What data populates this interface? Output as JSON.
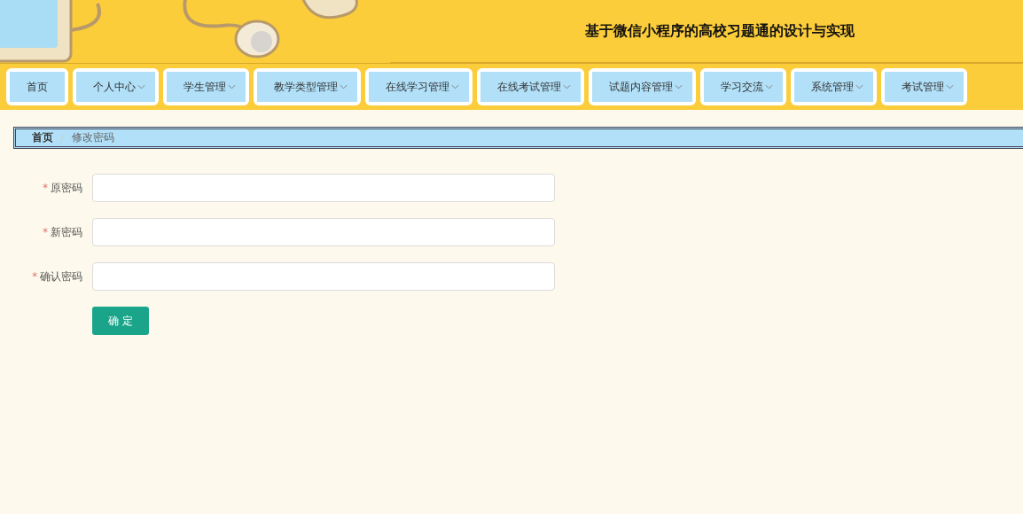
{
  "header": {
    "title": "基于微信小程序的高校习题通的设计与实现"
  },
  "nav": [
    {
      "label": "首页",
      "dropdown": false
    },
    {
      "label": "个人中心",
      "dropdown": true
    },
    {
      "label": "学生管理",
      "dropdown": true
    },
    {
      "label": "教学类型管理",
      "dropdown": true
    },
    {
      "label": "在线学习管理",
      "dropdown": true
    },
    {
      "label": "在线考试管理",
      "dropdown": true
    },
    {
      "label": "试题内容管理",
      "dropdown": true
    },
    {
      "label": "学习交流",
      "dropdown": true
    },
    {
      "label": "系统管理",
      "dropdown": true
    },
    {
      "label": "考试管理",
      "dropdown": true
    }
  ],
  "breadcrumb": [
    "首页",
    "修改密码"
  ],
  "form": {
    "fields": [
      {
        "label": "原密码",
        "required_mark": "*"
      },
      {
        "label": "新密码",
        "required_mark": "*"
      },
      {
        "label": "确认密码",
        "required_mark": "*"
      }
    ],
    "submit": "确 定"
  }
}
